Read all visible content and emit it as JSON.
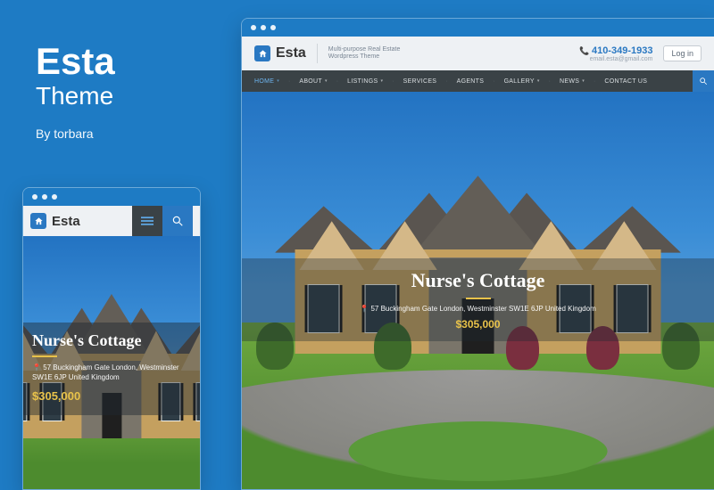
{
  "intro": {
    "title": "Esta",
    "subtitle": "Theme",
    "byline": "By torbara"
  },
  "brand": {
    "name": "Esta",
    "tagline_l1": "Multi-purpose Real Estate",
    "tagline_l2": "Wordpress Theme"
  },
  "contact": {
    "phone": "410-349-1933",
    "email": "email.esta@gmail.com"
  },
  "auth": {
    "login": "Log in"
  },
  "nav": {
    "items": [
      {
        "label": "HOME",
        "dropdown": true,
        "active": true
      },
      {
        "label": "ABOUT",
        "dropdown": true
      },
      {
        "label": "LISTINGS",
        "dropdown": true
      },
      {
        "label": "SERVICES"
      },
      {
        "label": "AGENTS"
      },
      {
        "label": "GALLERY",
        "dropdown": true
      },
      {
        "label": "NEWS",
        "dropdown": true
      },
      {
        "label": "CONTACT US"
      }
    ]
  },
  "listing": {
    "title": "Nurse's Cottage",
    "address_full": "57 Buckingham Gate London, Westminster SW1E 6JP United Kingdom",
    "address_l1": "57 Buckingham Gate London, Westminster",
    "address_l2": "SW1E 6JP United Kingdom",
    "price": "$305,000"
  }
}
